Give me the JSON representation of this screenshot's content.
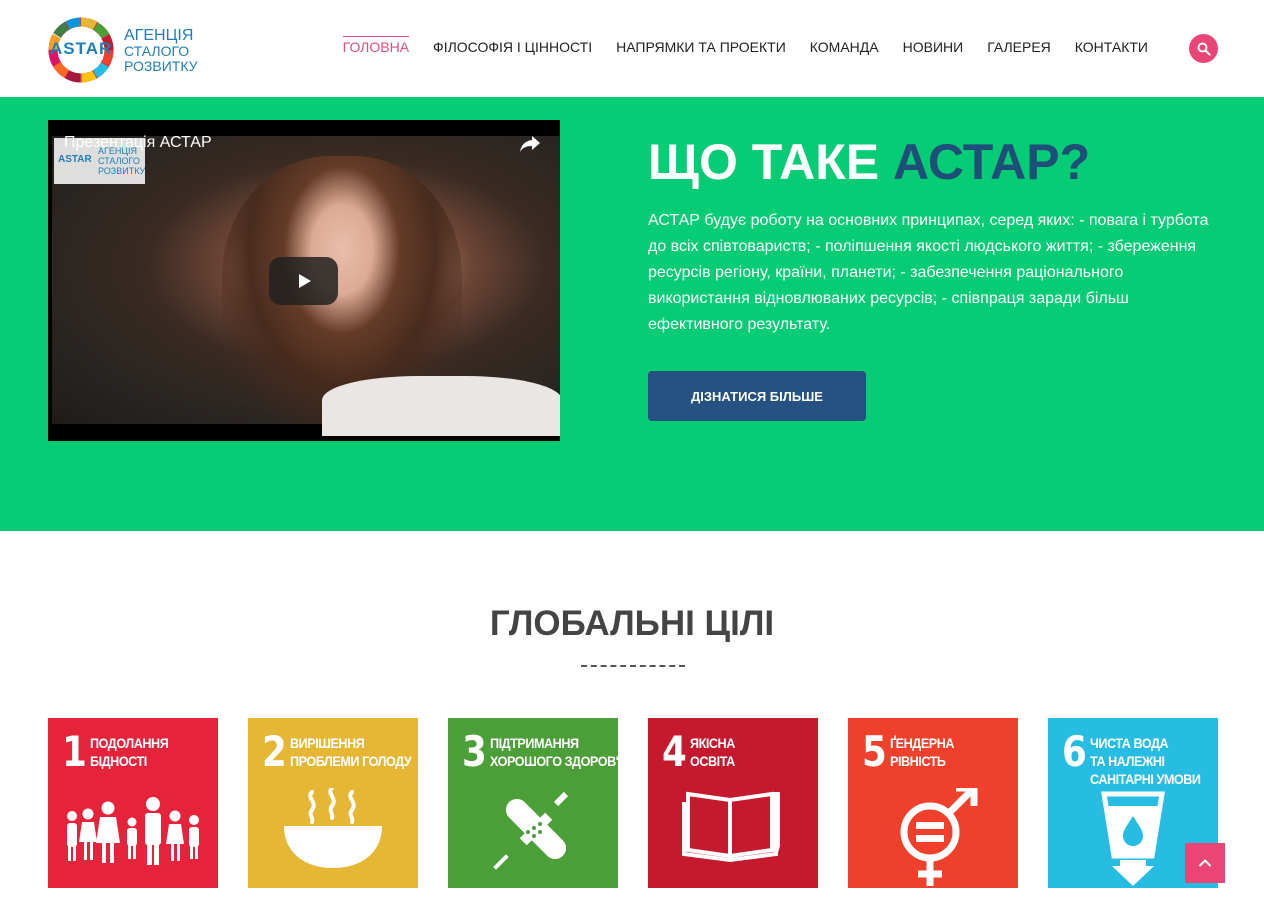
{
  "header": {
    "logo_word": "ASTAR",
    "logo_lines": [
      "АГЕНЦІЯ",
      "СТАЛОГО",
      "РОЗВИТКУ"
    ]
  },
  "nav": {
    "items": [
      {
        "label": "ГОЛОВНА",
        "active": true
      },
      {
        "label": "ФІЛОСОФІЯ І ЦІННОСТІ",
        "active": false
      },
      {
        "label": "НАПРЯМКИ ТА ПРОЕКТИ",
        "active": false
      },
      {
        "label": "КОМАНДА",
        "active": false
      },
      {
        "label": "НОВИНИ",
        "active": false
      },
      {
        "label": "ГАЛЕРЕЯ",
        "active": false
      },
      {
        "label": "КОНТАКТИ",
        "active": false
      }
    ],
    "search_icon": "search-icon"
  },
  "hero": {
    "video_title": "Презентація АСТАР",
    "video_badge_word": "ASTAR",
    "video_badge_lines": [
      "АГЕНЦІЯ",
      "СТАЛОГО",
      "РОЗВИТКУ"
    ],
    "title_main": "ЩО ТАКЕ ",
    "title_accent": "АСТАР?",
    "text": "АСТАР будує роботу на основних принципах, серед яких: - повага і турбота до всіх співтовариств; - поліпшення якості людського життя; - збереження ресурсів регіону, країни, планети; - забезпечення раціонального використання відновлюваних ресурсів; - співпраця заради більш ефективного результату.",
    "button_label": "ДІЗНАТИСЯ БІЛЬШЕ"
  },
  "goals": {
    "title": "ГЛОБАЛЬНІ ЦІЛІ",
    "items": [
      {
        "num": "1",
        "line1": "ПОДОЛАННЯ",
        "line2": "БІДНОСТІ",
        "line3": "",
        "color": "#e5243b"
      },
      {
        "num": "2",
        "line1": "ВИРІШЕННЯ",
        "line2": "ПРОБЛЕМИ ГОЛОДУ",
        "line3": "",
        "color": "#e5b735"
      },
      {
        "num": "3",
        "line1": "ПІДТРИМАННЯ",
        "line2": "ХОРОШОГО ЗДОРОВ'Я",
        "line3": "",
        "color": "#4c9f38"
      },
      {
        "num": "4",
        "line1": "ЯКІСНА",
        "line2": "ОСВІТА",
        "line3": "",
        "color": "#c5192d"
      },
      {
        "num": "5",
        "line1": "ҐЕНДЕРНА",
        "line2": "РІВНІСТЬ",
        "line3": "",
        "color": "#ef402b"
      },
      {
        "num": "6",
        "line1": "ЧИСТА ВОДА",
        "line2": "ТА НАЛЕЖНІ",
        "line3": "САНІТАРНІ УМОВИ",
        "color": "#27bde2"
      }
    ]
  },
  "scroll_top_icon": "chevron-up-icon"
}
